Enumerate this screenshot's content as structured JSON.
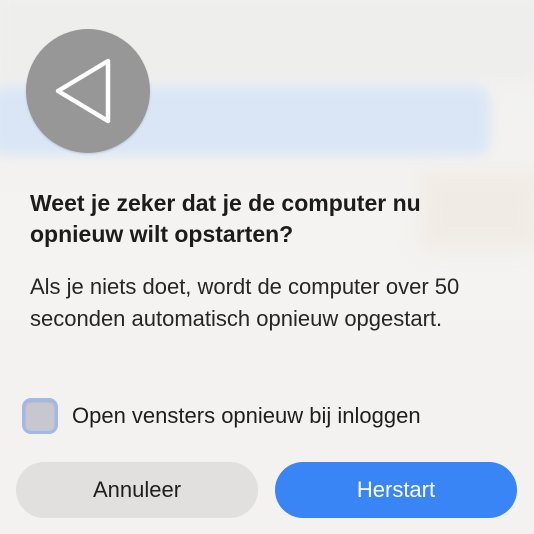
{
  "dialog": {
    "icon": "back-triangle-icon",
    "title": "Weet je zeker dat je de computer nu opnieuw wilt opstarten?",
    "message": "Als je niets doet, wordt de computer over 50 seconden automatisch opnieuw opgestart.",
    "checkbox": {
      "label": "Open vensters opnieuw bij inloggen",
      "checked": false
    },
    "buttons": {
      "cancel_label": "Annuleer",
      "confirm_label": "Herstart"
    }
  },
  "colors": {
    "accent": "#3a85f5",
    "icon_background": "#979797",
    "cancel_button": "#e1e0de"
  }
}
